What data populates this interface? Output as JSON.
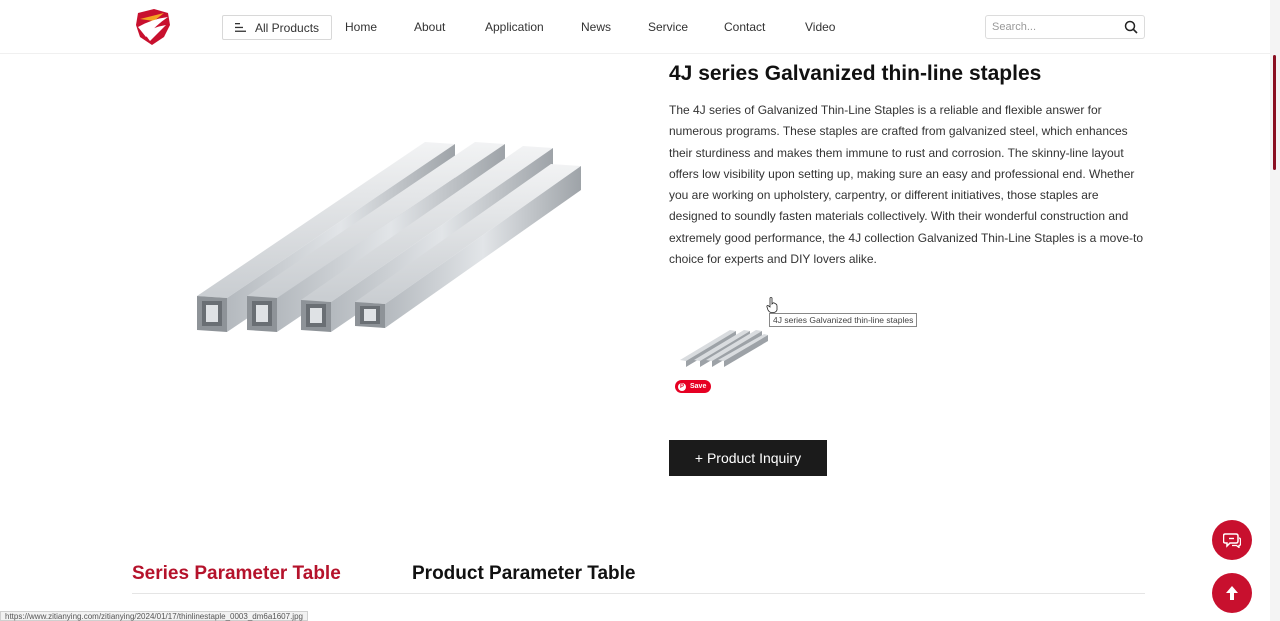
{
  "header": {
    "all_products_label": "All Products",
    "nav": [
      "Home",
      "About",
      "Application",
      "News",
      "Service",
      "Contact",
      "Video"
    ],
    "search_placeholder": "Search..."
  },
  "product": {
    "title": "4J series Galvanized thin-line staples",
    "description": "The 4J series of Galvanized Thin-Line Staples is a reliable and flexible answer for numerous programs. These staples are crafted from galvanized steel, which enhances their sturdiness and makes them immune to rust and corrosion. The skinny-line layout offers low visibility upon setting up, making sure an easy and professional end. Whether you are working on upholstery, carpentry, or different initiatives, those staples are designed to soundly fasten materials collectively. With their wonderful construction and extremely good performance, the 4J collection Galvanized Thin-Line Staples is a move-to choice for experts and DIY lovers alike.",
    "thumbnail_tooltip": "4J series Galvanized thin-line staples",
    "save_label": "Save",
    "inquiry_label": "+ Product Inquiry"
  },
  "tabs": {
    "series": "Series Parameter Table",
    "product": "Product Parameter Table"
  },
  "status_bar": {
    "url": "https://www.zitianying.com/zitianying/2024/01/17/thinlinestaple_0003_dm6a1607.jpg"
  },
  "colors": {
    "accent": "#c8102e",
    "tab_active": "#b5122b",
    "button_dark": "#1b1b1b"
  },
  "icons": {
    "logo": "eagle-logo",
    "menu": "menu-lines-icon",
    "search": "search-icon",
    "chat": "chat-icon",
    "back_to_top": "arrow-up-icon",
    "cursor": "hand-pointer-icon"
  }
}
